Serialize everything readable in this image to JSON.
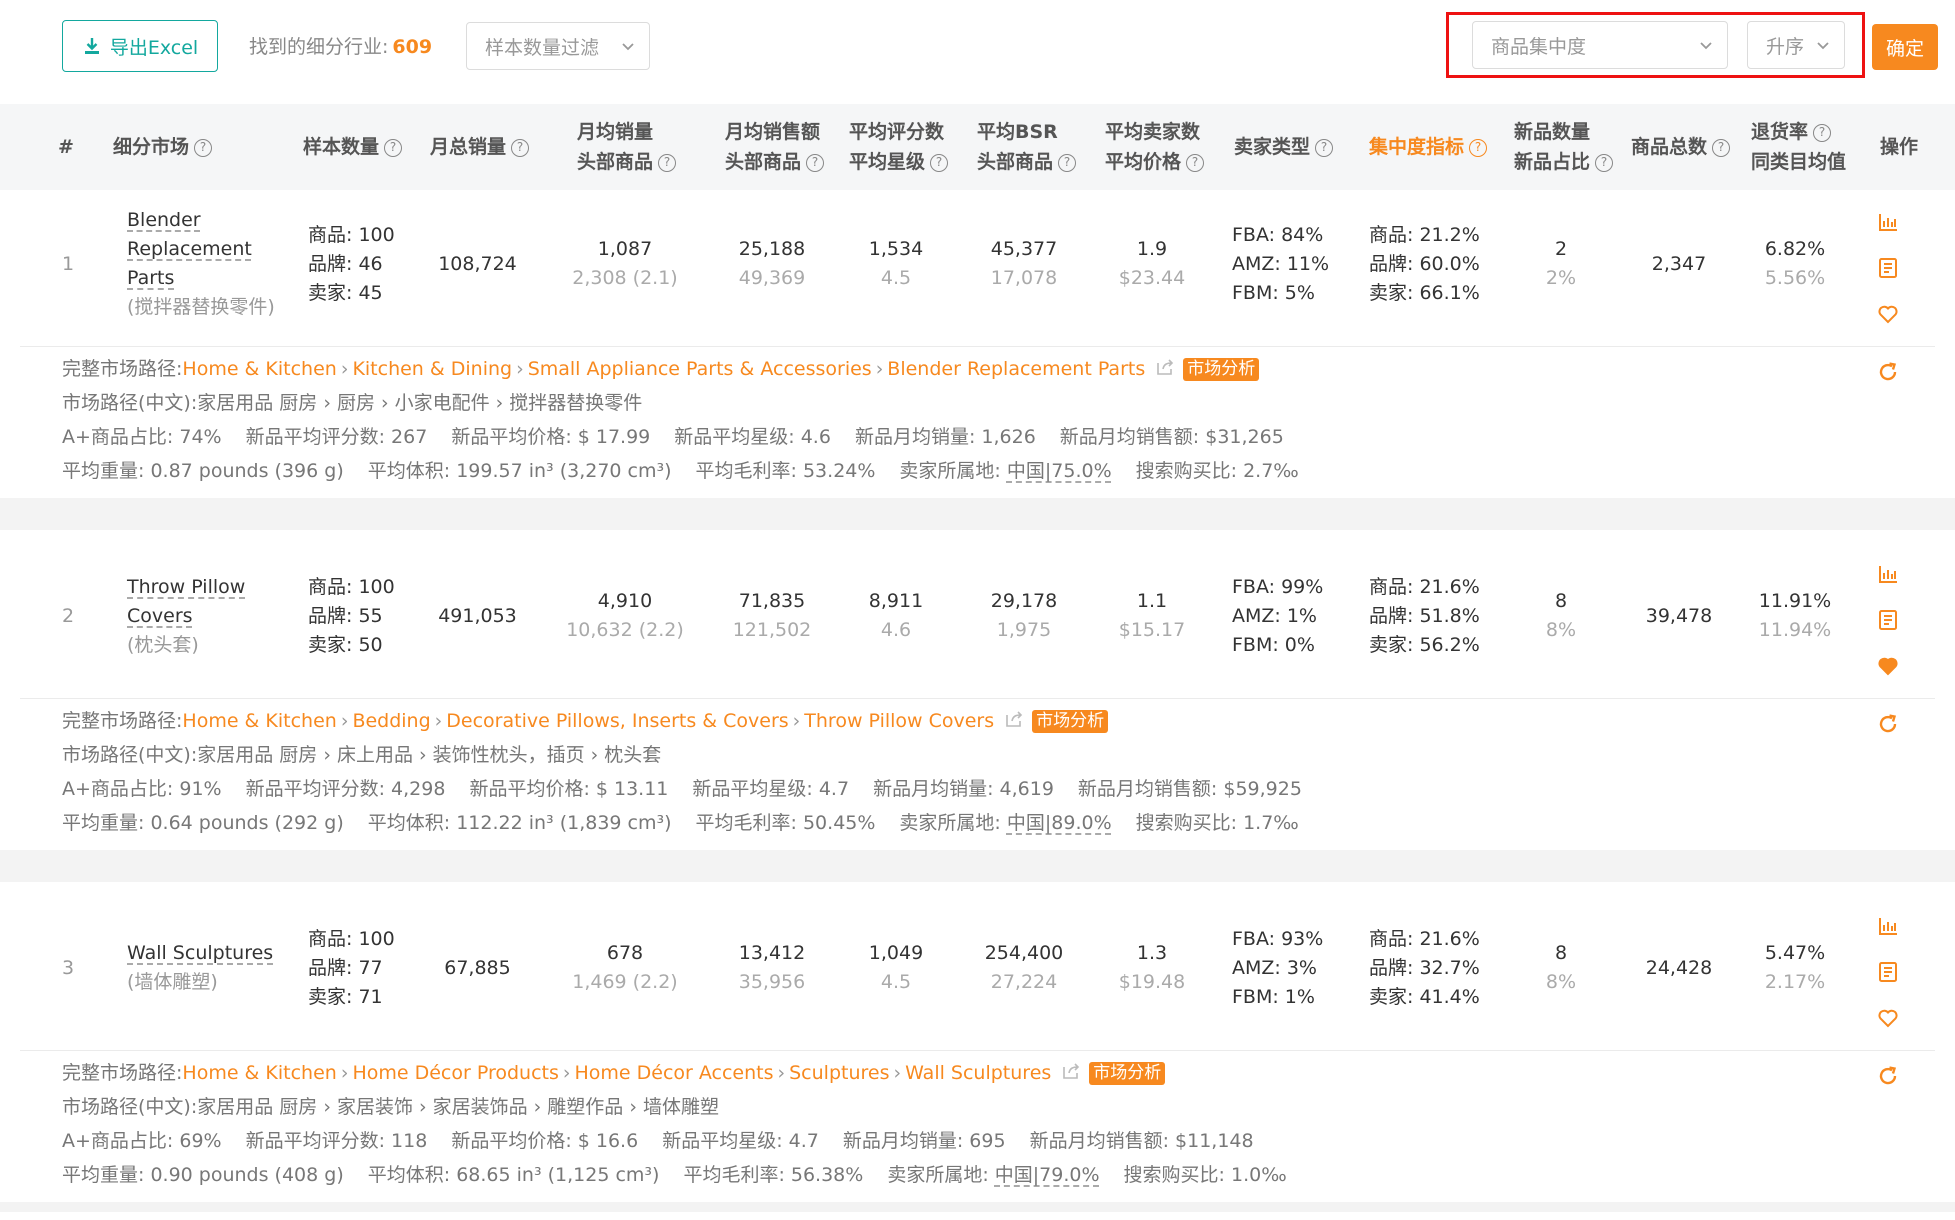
{
  "toolbar": {
    "export_label": "导出Excel",
    "found_label": "找到的细分行业:",
    "found_count": "609",
    "sample_filter_placeholder": "样本数量过滤",
    "sort_metric": "商品集中度",
    "sort_order": "升序",
    "confirm_label": "确定",
    "accent_color": "#f7891f",
    "teal_color": "#13a89e"
  },
  "header": {
    "idx": "#",
    "market": "细分市场",
    "sample": "样本数量",
    "monthly_sales": "月总销量",
    "avg_sales_1": "月均销量",
    "avg_sales_2": "头部商品",
    "avg_revenue_1": "月均销售额",
    "avg_revenue_2": "头部商品",
    "rating_1": "平均评分数",
    "rating_2": "平均星级",
    "bsr_1": "平均BSR",
    "bsr_2": "头部商品",
    "sellers_1": "平均卖家数",
    "sellers_2": "平均价格",
    "seller_type": "卖家类型",
    "concentration": "集中度指标",
    "new_1": "新品数量",
    "new_2": "新品占比",
    "total": "商品总数",
    "return_1": "退货率",
    "return_2": "同类目均值",
    "ops": "操作"
  },
  "rows": [
    {
      "idx": "1",
      "name_lines": [
        "Blender",
        "Replacement",
        "Parts"
      ],
      "name_cn": "(搅拌器替换零件)",
      "sample": [
        "商品: 100",
        "品牌: 46",
        "卖家: 45"
      ],
      "monthly_sales": "108,724",
      "avg_sales": "1,087",
      "avg_sales_sub": "2,308 (2.1)",
      "avg_revenue": "25,188",
      "avg_revenue_sub": "49,369",
      "rating": "1,534",
      "rating_sub": "4.5",
      "bsr": "45,377",
      "bsr_sub": "17,078",
      "sellers": "1.9",
      "price": "$23.44",
      "seller_type": [
        "FBA: 84%",
        "AMZ: 11%",
        "FBM: 5%"
      ],
      "concentration": [
        "商品: 21.2%",
        "品牌: 60.0%",
        "卖家: 66.1%"
      ],
      "new_count": "2",
      "new_pct": "2%",
      "total": "2,347",
      "return_rate": "6.82%",
      "return_avg": "5.56%",
      "favorited": false,
      "path_label": "完整市场路径:",
      "path": [
        "Home & Kitchen",
        "Kitchen & Dining",
        "Small Appliance Parts & Accessories",
        "Blender Replacement Parts"
      ],
      "analysis_tag": "市场分析",
      "path_cn_label": "市场路径(中文):",
      "path_cn": "家居用品 厨房 › 厨房 › 小家电配件 › 搅拌器替换零件",
      "stats_line": [
        "A+商品占比: 74%",
        "新品平均评分数: 267",
        "新品平均价格: $ 17.99",
        "新品平均星级: 4.6",
        "新品月均销量: 1,626",
        "新品月均销售额: $31,265"
      ],
      "weight": "平均重量: 0.87 pounds (396 g)",
      "volume": "平均体积: 199.57 in³ (3,270 cm³)",
      "margin": "平均毛利率: 53.24%",
      "location_label": "卖家所属地:",
      "location": "中国|75.0%",
      "search_ratio": "搜索购买比: 2.7‰"
    },
    {
      "idx": "2",
      "name_lines": [
        "Throw Pillow",
        "Covers"
      ],
      "name_cn": "(枕头套)",
      "sample": [
        "商品: 100",
        "品牌: 55",
        "卖家: 50"
      ],
      "monthly_sales": "491,053",
      "avg_sales": "4,910",
      "avg_sales_sub": "10,632 (2.2)",
      "avg_revenue": "71,835",
      "avg_revenue_sub": "121,502",
      "rating": "8,911",
      "rating_sub": "4.6",
      "bsr": "29,178",
      "bsr_sub": "1,975",
      "sellers": "1.1",
      "price": "$15.17",
      "seller_type": [
        "FBA: 99%",
        "AMZ: 1%",
        "FBM: 0%"
      ],
      "concentration": [
        "商品: 21.6%",
        "品牌: 51.8%",
        "卖家: 56.2%"
      ],
      "new_count": "8",
      "new_pct": "8%",
      "total": "39,478",
      "return_rate": "11.91%",
      "return_avg": "11.94%",
      "favorited": true,
      "path_label": "完整市场路径:",
      "path": [
        "Home & Kitchen",
        "Bedding",
        "Decorative Pillows, Inserts & Covers",
        "Throw Pillow Covers"
      ],
      "analysis_tag": "市场分析",
      "path_cn_label": "市场路径(中文):",
      "path_cn": "家居用品 厨房 › 床上用品 › 装饰性枕头，插页 › 枕头套",
      "stats_line": [
        "A+商品占比: 91%",
        "新品平均评分数: 4,298",
        "新品平均价格: $ 13.11",
        "新品平均星级: 4.7",
        "新品月均销量: 4,619",
        "新品月均销售额: $59,925"
      ],
      "weight": "平均重量: 0.64 pounds (292 g)",
      "volume": "平均体积: 112.22 in³ (1,839 cm³)",
      "margin": "平均毛利率: 50.45%",
      "location_label": "卖家所属地:",
      "location": "中国|89.0%",
      "search_ratio": "搜索购买比: 1.7‰"
    },
    {
      "idx": "3",
      "name_lines": [
        "Wall Sculptures"
      ],
      "name_cn": "(墙体雕塑)",
      "sample": [
        "商品: 100",
        "品牌: 77",
        "卖家: 71"
      ],
      "monthly_sales": "67,885",
      "avg_sales": "678",
      "avg_sales_sub": "1,469 (2.2)",
      "avg_revenue": "13,412",
      "avg_revenue_sub": "35,956",
      "rating": "1,049",
      "rating_sub": "4.5",
      "bsr": "254,400",
      "bsr_sub": "27,224",
      "sellers": "1.3",
      "price": "$19.48",
      "seller_type": [
        "FBA: 93%",
        "AMZ: 3%",
        "FBM: 1%"
      ],
      "concentration": [
        "商品: 21.6%",
        "品牌: 32.7%",
        "卖家: 41.4%"
      ],
      "new_count": "8",
      "new_pct": "8%",
      "total": "24,428",
      "return_rate": "5.47%",
      "return_avg": "2.17%",
      "favorited": false,
      "path_label": "完整市场路径:",
      "path": [
        "Home & Kitchen",
        "Home Décor Products",
        "Home Décor Accents",
        "Sculptures",
        "Wall Sculptures"
      ],
      "analysis_tag": "市场分析",
      "path_cn_label": "市场路径(中文):",
      "path_cn": "家居用品 厨房 › 家居装饰 › 家居装饰品 › 雕塑作品 › 墙体雕塑",
      "stats_line": [
        "A+商品占比: 69%",
        "新品平均评分数: 118",
        "新品平均价格: $ 16.6",
        "新品平均星级: 4.7",
        "新品月均销量: 695",
        "新品月均销售额: $11,148"
      ],
      "weight": "平均重量: 0.90 pounds (408 g)",
      "volume": "平均体积: 68.65 in³ (1,125 cm³)",
      "margin": "平均毛利率: 56.38%",
      "location_label": "卖家所属地:",
      "location": "中国|79.0%",
      "search_ratio": "搜索购买比: 1.0‰"
    }
  ],
  "icons": {
    "export": "download-icon",
    "chart": "bar-chart-icon",
    "detail": "document-icon",
    "favorite": "heart-icon",
    "refresh": "refresh-icon",
    "external": "share-icon",
    "help": "question-circle-icon"
  }
}
